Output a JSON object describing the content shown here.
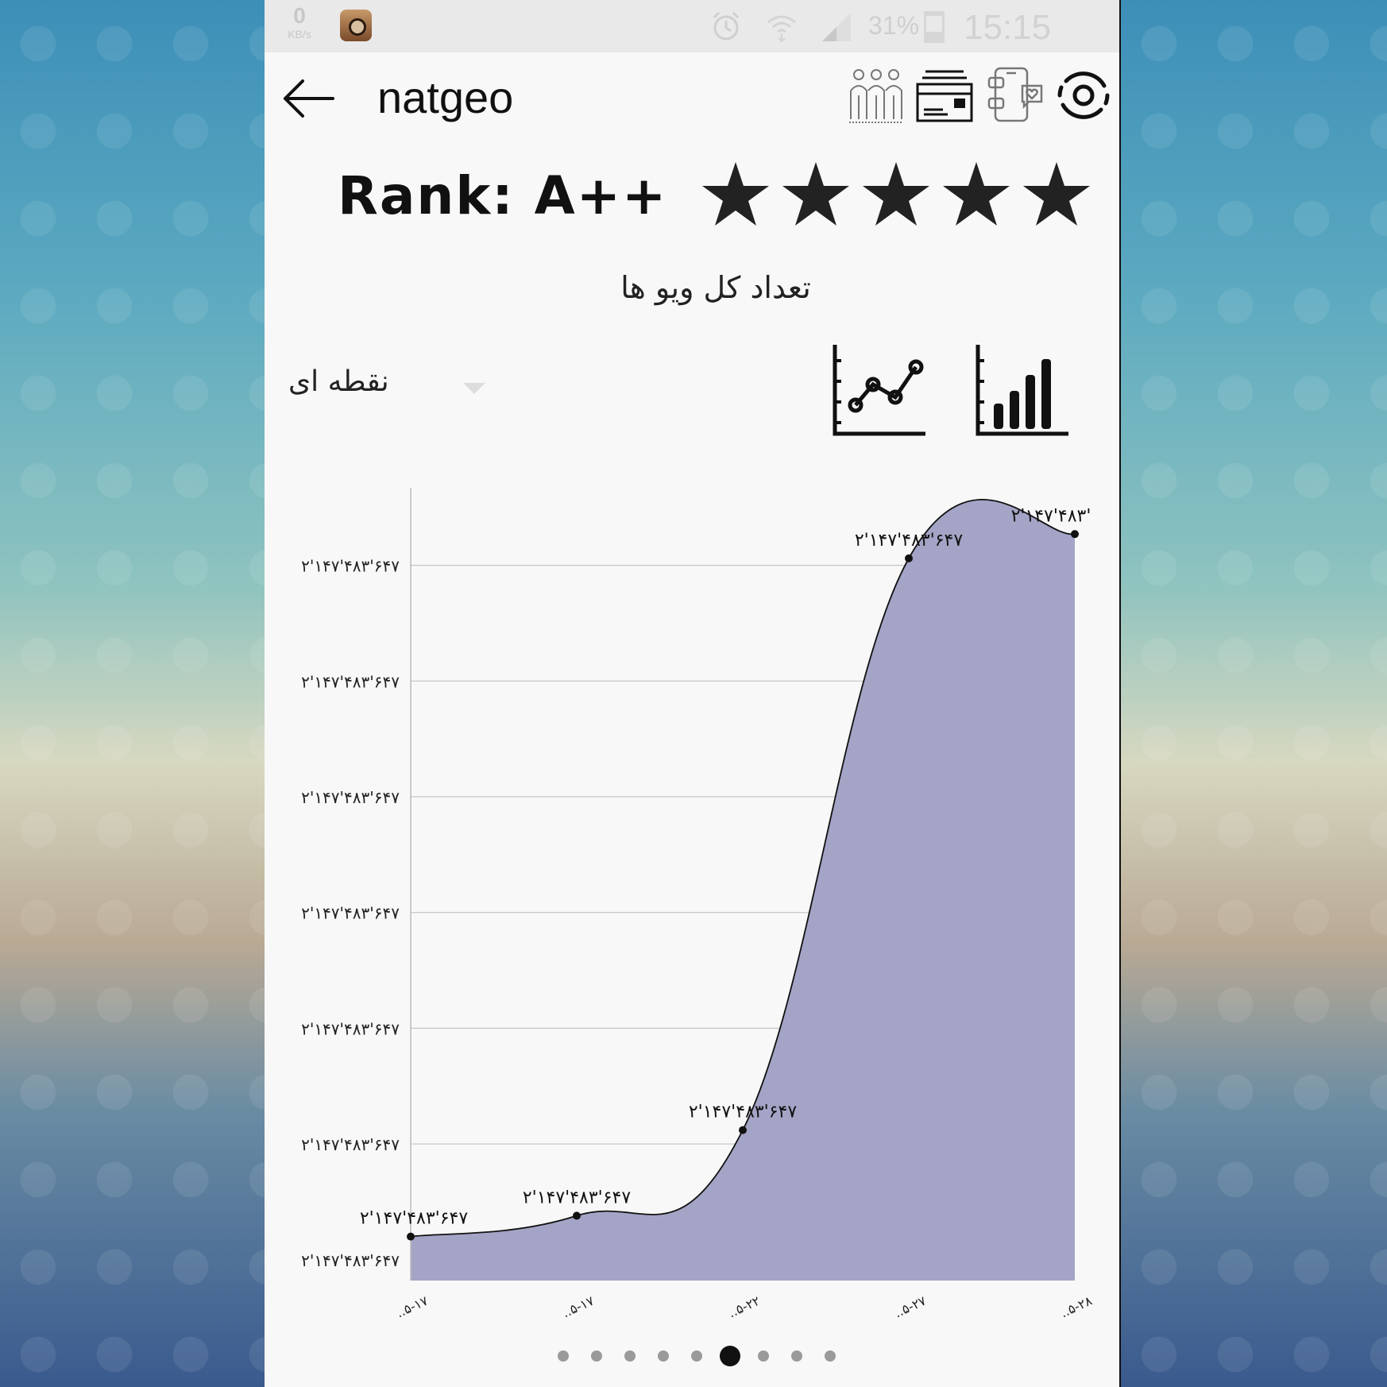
{
  "status_bar": {
    "net_speed_value": "0",
    "net_speed_unit": "KB/s",
    "battery": "31%",
    "time": "15:15",
    "icons": [
      "instagram-app-icon",
      "alarm-icon",
      "wifi-icon",
      "signal-icon",
      "battery-icon"
    ]
  },
  "header": {
    "title": "natgeo",
    "icons": [
      "back-arrow-icon",
      "followers-icon",
      "card-icon",
      "phone-likes-icon",
      "settings-ring-icon"
    ]
  },
  "rank": {
    "label": "Rank: A++",
    "stars": 5
  },
  "chart_title": "تعداد کل ویو ها",
  "chart_mode": {
    "selected": "نقطه ای",
    "icons": [
      "line-chart-icon",
      "bar-chart-icon"
    ]
  },
  "chart_data": {
    "type": "area",
    "title": "",
    "xlabel": "",
    "ylabel": "",
    "fill_color": "#a3a4c6",
    "grid": true,
    "x": [
      "..۵-۱۷",
      "..۵-۱۷",
      "..۵-۲۲",
      "..۵-۲۷",
      "..۵-۲۸"
    ],
    "values": [
      0.2,
      0.38,
      1.12,
      6.06,
      6.27
    ],
    "point_labels": [
      "۲'۱۴۷'۴۸۳'۶۴۷",
      "۲'۱۴۷'۴۸۳'۶۴۷",
      "۲'۱۴۷'۴۸۳'۶۴۷",
      "۲'۱۴۷'۴۸۳'۶۴۷",
      "۲'۱۴۷'۴۸۳'"
    ],
    "y_ticks": [
      "۲'۱۴۷'۴۸۳'۶۴۷",
      "۲'۱۴۷'۴۸۳'۶۴۷",
      "۲'۱۴۷'۴۸۳'۶۴۷",
      "۲'۱۴۷'۴۸۳'۶۴۷",
      "۲'۱۴۷'۴۸۳'۶۴۷",
      "۲'۱۴۷'۴۸۳'۶۴۷",
      "۲'۱۴۷'۴۸۳'۶۴۷"
    ],
    "y_tick_values": [
      0,
      1,
      2,
      3,
      4,
      5,
      6
    ],
    "ylim": [
      -0.18,
      6.67
    ]
  },
  "pager": {
    "count": 9,
    "active_index": 5
  }
}
